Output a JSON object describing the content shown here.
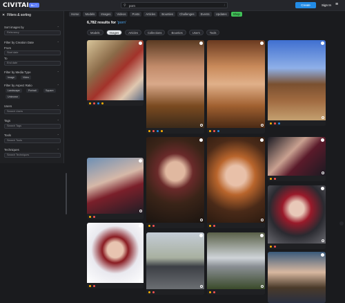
{
  "header": {
    "logo": "CIVITAI",
    "badge": "Bu ♡",
    "search_value": "porn",
    "search_slash": "/",
    "create_label": "Create",
    "signin_label": "Sign In"
  },
  "nav": [
    "Home",
    "Models",
    "Images",
    "Videos",
    "Posts",
    "Articles",
    "Bounties",
    "Challenges",
    "Events",
    "Updates",
    "Shop"
  ],
  "sidebar": {
    "title": "Filters & sorting",
    "sort_label": "Sort images by",
    "sort_value": "Relevancy",
    "creation_label": "Filter by Creation Date",
    "from_label": "From",
    "from_placeholder": "Start date",
    "to_label": "To",
    "to_placeholder": "End date",
    "media_label": "Filter by Media Type",
    "media_options": [
      "Image",
      "Video"
    ],
    "aspect_label": "Filter by Aspect Ratio",
    "aspect_options": [
      "Landscape",
      "Portrait",
      "Square",
      "Unknown"
    ],
    "users_label": "Users",
    "users_placeholder": "Search Users",
    "tags_label": "Tags",
    "tags_placeholder": "Search Tags",
    "tools_label": "Tools",
    "tools_placeholder": "Search Tools",
    "techniques_label": "Techniques",
    "techniques_placeholder": "Search Techniques"
  },
  "results": {
    "count_text": "6,782 results for",
    "query": "'porn'"
  },
  "tabs": [
    "Models",
    "Images",
    "Articles",
    "Collections",
    "Bounties",
    "Users",
    "Tools"
  ],
  "active_tab": "Images",
  "colors": {
    "accent": "#228be6",
    "shop": "#40c057",
    "background": "#1a1b1e"
  }
}
